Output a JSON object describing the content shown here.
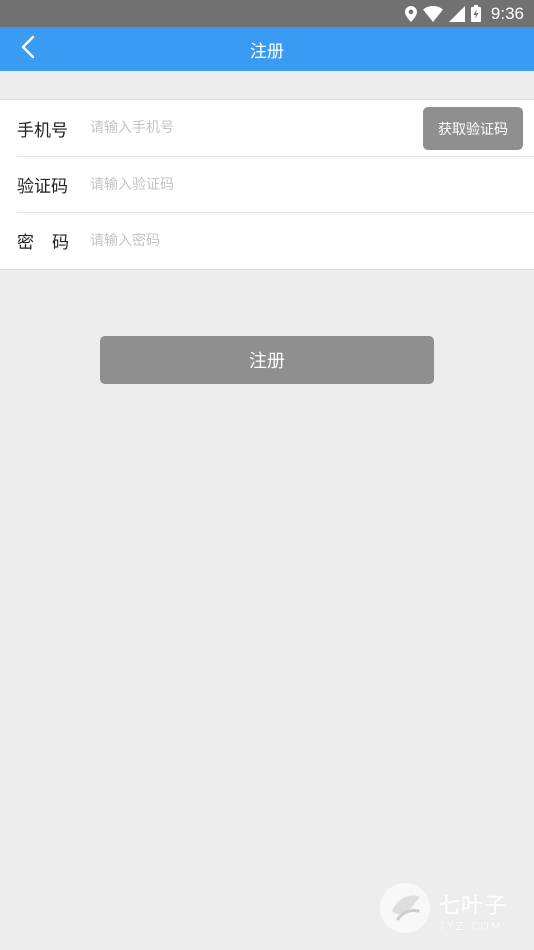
{
  "status_bar": {
    "time": "9:36",
    "icons": [
      "location-icon",
      "wifi-icon",
      "signal-icon",
      "battery-charging-icon"
    ]
  },
  "app_bar": {
    "title": "注册",
    "back_icon": "chevron-left-icon",
    "color": "#3a9bf4"
  },
  "form": {
    "phone": {
      "label": "手机号",
      "value": "",
      "placeholder": "请输入手机号",
      "code_button": "获取验证码"
    },
    "code": {
      "label": "验证码",
      "value": "",
      "placeholder": "请输入验证码"
    },
    "password": {
      "label": "密码",
      "value": "",
      "placeholder": "请输入密码"
    }
  },
  "submit": {
    "label": "注册"
  },
  "watermark": {
    "name": "七叶子",
    "domain": "7YZ.COM"
  }
}
